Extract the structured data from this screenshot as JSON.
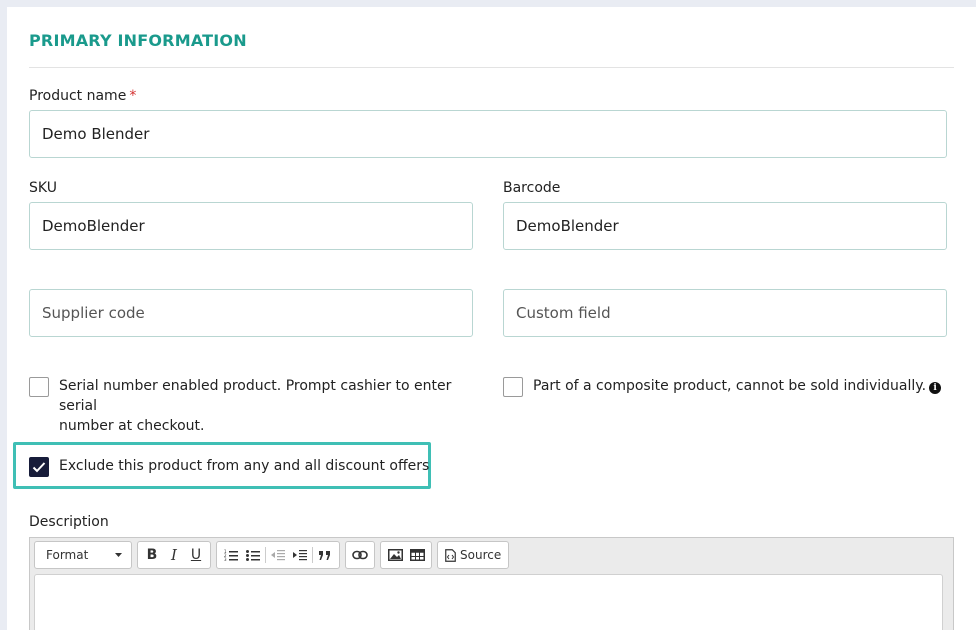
{
  "section": {
    "title": "PRIMARY INFORMATION"
  },
  "product_name": {
    "label": "Product name",
    "required_mark": "*",
    "value": "Demo Blender"
  },
  "sku": {
    "label": "SKU",
    "value": "DemoBlender"
  },
  "barcode": {
    "label": "Barcode",
    "value": "DemoBlender"
  },
  "supplier_code": {
    "placeholder": "Supplier code"
  },
  "custom_field": {
    "placeholder": "Custom field"
  },
  "checkboxes": {
    "serial": {
      "line1": "Serial number enabled product. Prompt cashier to enter serial",
      "line2": "number at checkout.",
      "checked": false
    },
    "composite": {
      "label": "Part of a composite product, cannot be sold individually.",
      "checked": false
    },
    "exclude_discount": {
      "label": "Exclude this product from any and all discount offers",
      "checked": true
    }
  },
  "description": {
    "label": "Description",
    "toolbar": {
      "format_label": "Format",
      "bold": "B",
      "italic": "I",
      "underline": "U",
      "source_label": "Source"
    }
  },
  "colors": {
    "accent": "#1a9a8c",
    "highlight": "#3fbfb5",
    "checkbox_checked": "#171c3a",
    "required": "#d32f2f"
  }
}
